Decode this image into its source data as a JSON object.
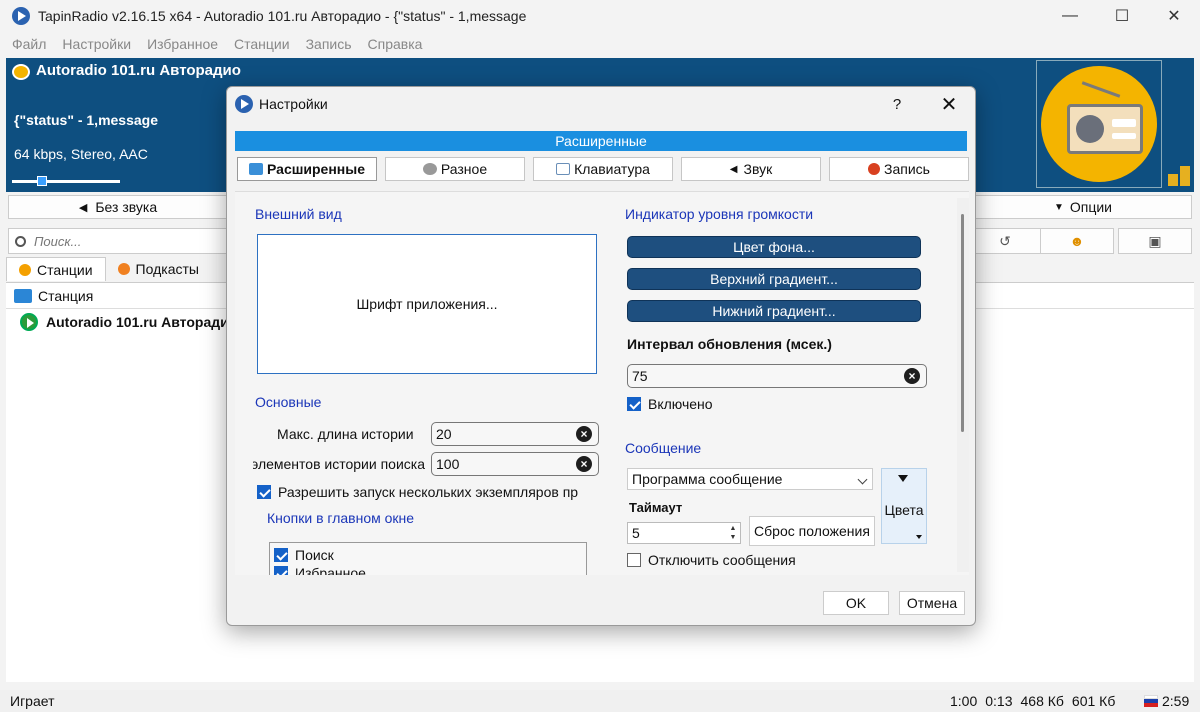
{
  "window": {
    "title": "TapinRadio v2.16.15 x64  - Autoradio 101.ru Авторадио - {\"status\" - 1,message",
    "minimize": "—",
    "maximize": "☐",
    "close": "✕"
  },
  "menu": [
    "Файл",
    "Настройки",
    "Избранное",
    "Станции",
    "Запись",
    "Справка"
  ],
  "player": {
    "station": "Autoradio 101.ru Авторадио",
    "song": "{\"status\" - 1,message",
    "bitrate": "64 kbps, Stereo, AAC",
    "volume_fraction": 0.25
  },
  "controls": {
    "mute_label": "Без звука",
    "mute_icon": "speaker-icon",
    "options_label": "Опции",
    "options_icon": "chevron-down-icon"
  },
  "search": {
    "placeholder": "Поиск..."
  },
  "tools": [
    {
      "icon": "rewind-icon",
      "glyph": "↺"
    },
    {
      "icon": "favorite-icon",
      "glyph": "☻"
    },
    {
      "icon": "image-icon",
      "glyph": "▣"
    }
  ],
  "tabs": [
    {
      "label": "Станции",
      "icon": "stations-icon"
    },
    {
      "label": "Подкасты",
      "icon": "podcasts-icon"
    }
  ],
  "list": {
    "header": "Станция",
    "rows": [
      "Autoradio 101.ru Авторадио"
    ]
  },
  "status": {
    "state": "Играет",
    "time": "1:00",
    "elapsed": "0:13",
    "size1": "468 Кб",
    "size2": "601 Кб",
    "clock": "2:59"
  },
  "dialog": {
    "title": "Настройки",
    "help": "?",
    "close": "✕",
    "section": "Расширенные",
    "tabs": [
      {
        "label": "Расширенные",
        "icon": "advanced-icon",
        "color": "#3a8fd8",
        "active": true
      },
      {
        "label": "Разное",
        "icon": "gear-icon",
        "color": "#888888",
        "active": false
      },
      {
        "label": "Клавиатура",
        "icon": "keyboard-icon",
        "color": "#6a8fb8",
        "active": false
      },
      {
        "label": "Звук",
        "icon": "speaker-icon",
        "color": "#555555",
        "active": false
      },
      {
        "label": "Запись",
        "icon": "record-icon",
        "color": "#d84020",
        "active": false
      }
    ],
    "appearance": {
      "title": "Внешний вид",
      "font_button": "Шрифт приложения..."
    },
    "basic": {
      "title": "Основные",
      "history_label": "Макс. длина истории",
      "history_value": "20",
      "search_history_label": "элементов истории поиска",
      "search_history_value": "100",
      "multi_instance_label": "Разрешить запуск нескольких экземпляров пр",
      "multi_instance_checked": true,
      "main_buttons_title": "Кнопки в главном окне",
      "main_buttons": [
        {
          "label": "Поиск",
          "checked": true
        },
        {
          "label": "Избранное",
          "checked": true
        }
      ]
    },
    "volume_indicator": {
      "title": "Индикатор уровня громкости",
      "bg_color": "Цвет фона...",
      "top_gradient": "Верхний градиент...",
      "bottom_gradient": "Нижний градиент...",
      "interval_label": "Интервал обновления (мсек.)",
      "interval_value": "75",
      "enabled_label": "Включено",
      "enabled_checked": true
    },
    "message": {
      "title": "Сообщение",
      "program_combo": "Программа сообщение",
      "colors_label": "Цвета",
      "timeout_label": "Таймаут",
      "timeout_value": "5",
      "reset_label": "Сброс положения",
      "disable_label": "Отключить сообщения",
      "disable_checked": false
    },
    "ok": "OK",
    "cancel": "Отмена"
  },
  "colors": {
    "accent": "#1a8fe0",
    "player_bg": "#0e4f80",
    "group_title": "#1b36b8",
    "dark_button": "#1e4f7f"
  }
}
